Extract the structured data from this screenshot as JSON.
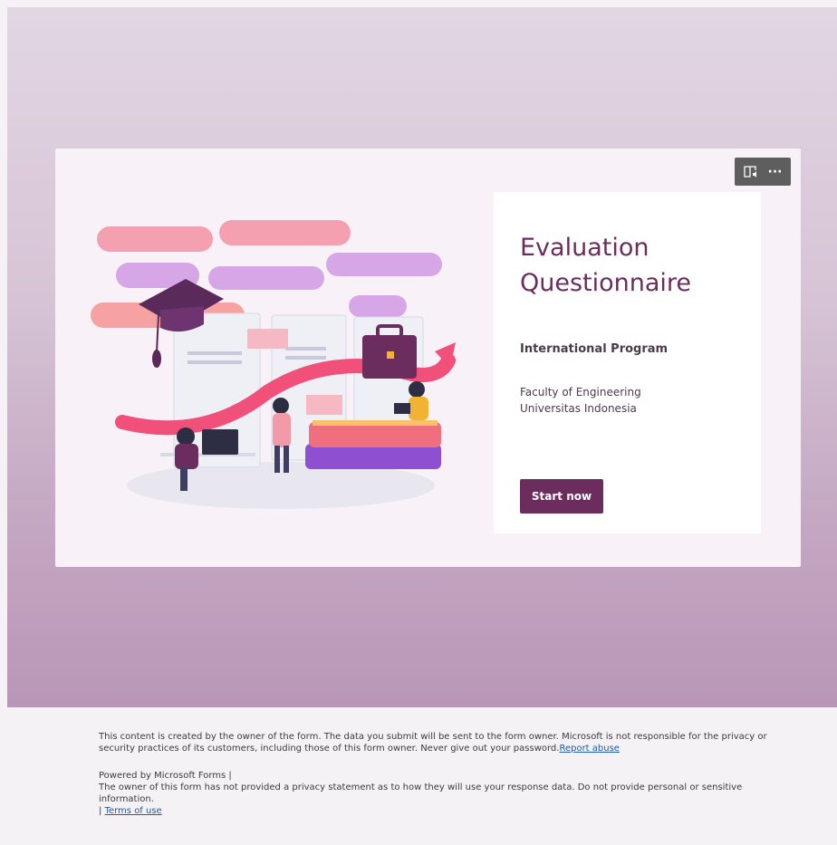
{
  "form": {
    "title": "Evaluation Questionnaire",
    "subtitle": "International Program",
    "description": "Faculty of Engineering\nUniversitas Indonesia",
    "start_label": "Start now"
  },
  "toolbar": {
    "icons": [
      "immersive-reader-icon",
      "more-options-icon"
    ],
    "more_label": "···"
  },
  "footer": {
    "disclaimer": "This content is created by the owner of the form. The data you submit will be sent to the form owner. Microsoft is not responsible for the privacy or security practices of its customers, including those of this form owner. Never give out your password.",
    "report_abuse": "Report abuse",
    "powered_by": "Powered by Microsoft Forms |",
    "privacy_note": "The owner of this form has not provided a privacy statement as to how they will use your response data. Do not provide personal or sensitive information.",
    "terms_separator": "|",
    "terms_of_use": "Terms of use"
  },
  "colors": {
    "accent": "#6b2d5e",
    "card_bg": "#f8f1f8",
    "toolbar_bg": "#5e5e5e",
    "link": "#1a5bb3"
  }
}
